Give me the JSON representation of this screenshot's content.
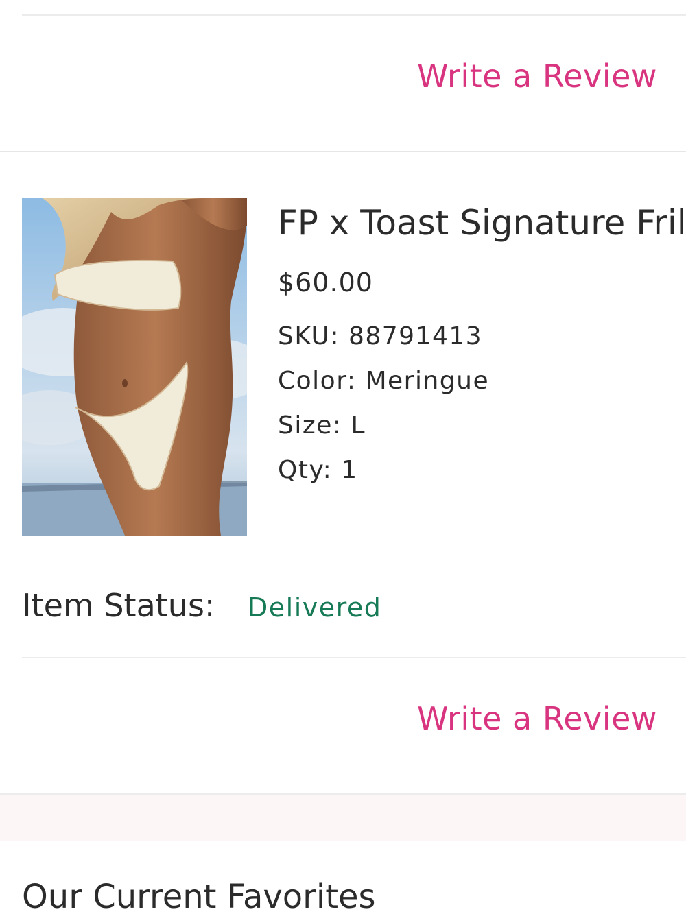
{
  "reviews": {
    "top_link": "Write a Review",
    "bottom_link": "Write a Review"
  },
  "item": {
    "title": "FP x Toast Signature Frill I",
    "price": "$60.00",
    "sku_label": "SKU:",
    "sku_value": "88791413",
    "color_label": "Color:",
    "color_value": "Meringue",
    "size_label": "Size:",
    "size_value": "L",
    "qty_label": "Qty:",
    "qty_value": "1",
    "image_icon": "product-photo-bikini"
  },
  "status": {
    "label": "Item Status:",
    "value": "Delivered",
    "color": "#177a56"
  },
  "favorites": {
    "heading": "Our Current Favorites"
  },
  "colors": {
    "accent": "#d8347f",
    "text": "#2b2b2b",
    "band": "#fdf6f6"
  }
}
